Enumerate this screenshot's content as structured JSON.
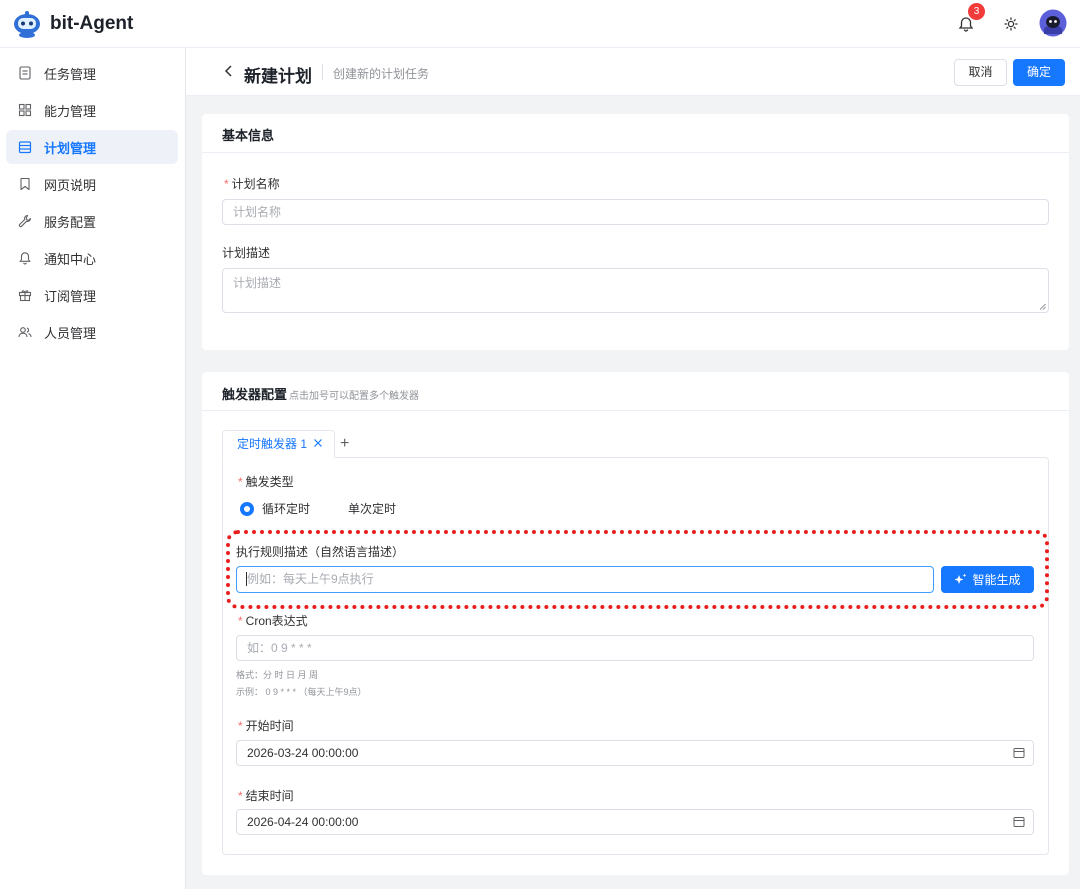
{
  "app": {
    "brand": "bit-Agent",
    "notification_count": "3"
  },
  "sidebar": {
    "items": [
      {
        "label": "任务管理",
        "icon": "document-icon"
      },
      {
        "label": "能力管理",
        "icon": "grid-icon"
      },
      {
        "label": "计划管理",
        "icon": "calendar-icon",
        "active": true
      },
      {
        "label": "网页说明",
        "icon": "bookmark-icon"
      },
      {
        "label": "服务配置",
        "icon": "wrench-icon"
      },
      {
        "label": "通知中心",
        "icon": "bell-icon"
      },
      {
        "label": "订阅管理",
        "icon": "gift-icon"
      },
      {
        "label": "人员管理",
        "icon": "users-icon"
      }
    ]
  },
  "header": {
    "title": "新建计划",
    "subtitle": "创建新的计划任务",
    "cancel_label": "取消",
    "confirm_label": "确定"
  },
  "basic": {
    "title": "基本信息",
    "name_label": "计划名称",
    "name_placeholder": "计划名称",
    "desc_label": "计划描述",
    "desc_placeholder": "计划描述"
  },
  "trigger": {
    "title": "触发器配置",
    "hint": "点击加号可以配置多个触发器",
    "tab_label": "定时触发器 1",
    "add_symbol": "+",
    "type_label": "触发类型",
    "type_options": [
      "循环定时",
      "单次定时"
    ],
    "type_selected": "循环定时",
    "nl_label": "执行规则描述（自然语言描述）",
    "nl_placeholder": "例如：每天上午9点执行",
    "ai_button": "智能生成",
    "cron_label": "Cron表达式",
    "cron_placeholder": "如：0 9 * * *",
    "cron_format": "格式：分 时 日 月 周",
    "cron_example": "示例：   0 9 * * *   （每天上午9点）",
    "start_label": "开始时间",
    "start_value": "2026-03-24 00:00:00",
    "end_label": "结束时间",
    "end_value": "2026-04-24 00:00:00"
  },
  "colors": {
    "primary": "#1677ff",
    "required": "#f56c6c",
    "highlight": "#e81f1f",
    "badge": "#f23c3c"
  }
}
